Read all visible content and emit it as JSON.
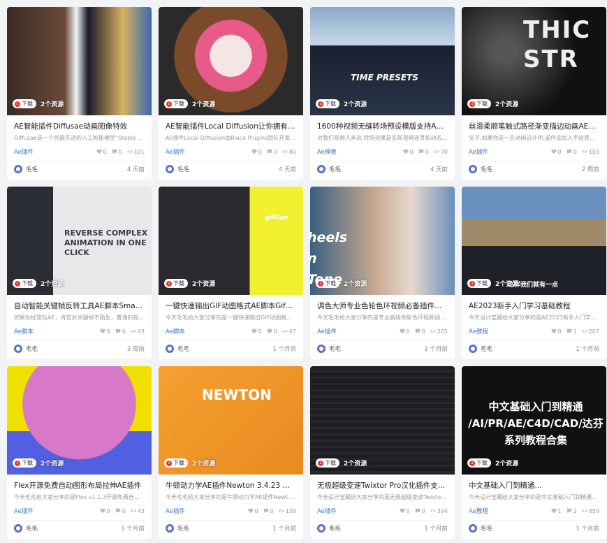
{
  "cards": [
    {
      "title": "AE智能插件Diffusae动画图像特效",
      "desc": "Diffusae是一个将最先进的人工智能模型“Stable D...",
      "tag": "Ae插件",
      "likes": "0",
      "comments": "0",
      "views": "101",
      "author": "毛毛",
      "time": "4 天前",
      "badge": "下载",
      "res": "2个资源",
      "art_text": ""
    },
    {
      "title": "AE智能插件Local Diffusion让你拥有24...",
      "desc": "AE插件Local Diffusion由Blace Plugins团队开发,...",
      "tag": "Ae插件",
      "likes": "0",
      "comments": "0",
      "views": "80",
      "author": "毛毛",
      "time": "4 天前",
      "badge": "下载",
      "res": "2个资源",
      "art_text": ""
    },
    {
      "title": "1600种视频无缝转场预设模版支持AE和...",
      "desc": "对我们视频人来说,转场效果是实现视频连贯和动态...",
      "tag": "Ae模板",
      "likes": "0",
      "comments": "0",
      "views": "70",
      "author": "毛毛",
      "time": "4 天前",
      "badge": "下载",
      "res": "2个资源",
      "art_text": "TIME PRESETS"
    },
    {
      "title": "丝滑柔顺笔触式路径渐变描边动画AE插...",
      "desc": "宝子,如果你是一名动画设计师,或作品加入手绘质...",
      "tag": "Ae插件",
      "likes": "0",
      "comments": "0",
      "views": "103",
      "author": "毛毛",
      "time": "2 周前",
      "badge": "下载",
      "res": "2个资源",
      "art_text": "THIC STR"
    },
    {
      "title": "自动智能关键帧反转工具AE脚本Smart...",
      "desc": "如果你经常玩AE，肯定对关键帧不陌生，普通的视...",
      "tag": "Ae脚本",
      "likes": "0",
      "comments": "0",
      "views": "43",
      "author": "毛毛",
      "time": "3 周前",
      "badge": "下载",
      "res": "2个资源",
      "art_text": "REVERSE COMPLEX ANIMATION IN ONE CLICK"
    },
    {
      "title": "一键快速输出GIF动图格式AE脚本GifGun",
      "desc": "今天毛毛给大家分享的是一键快速输出GIF动图格...",
      "tag": "Ae脚本",
      "likes": "0",
      "comments": "0",
      "views": "67",
      "author": "毛毛",
      "time": "1 个月前",
      "badge": "下载",
      "res": "2个资源",
      "art_text": "gifGun"
    },
    {
      "title": "调色大师专业色轮色环视频必备插件...",
      "desc": "今天毛毛给大家分享的是专业高级色轮色环视频调...",
      "tag": "Ae插件",
      "likes": "0",
      "comments": "0",
      "views": "205",
      "author": "毛毛",
      "time": "1 个月前",
      "badge": "下载",
      "res": "2个资源",
      "art_text": "heels n Tone"
    },
    {
      "title": "AE2023新手入门学习基础教程",
      "desc": "今天设计宝藏给大家分享的是AE2023新手入门学...",
      "tag": "Ae教程",
      "likes": "0",
      "comments": "1",
      "views": "207",
      "author": "毛毛",
      "time": "1 个月前",
      "badge": "下载",
      "res": "2个资源",
      "art_text": "这样我们就有一点"
    },
    {
      "title": "Flex开源免费自动图形布局拉伸AE插件",
      "desc": "今天毛毛给大家分享的是Flex v1.1.3开源免费自动...",
      "tag": "Ae插件",
      "likes": "0",
      "comments": "0",
      "views": "43",
      "author": "毛毛",
      "time": "1 个月前",
      "badge": "下载",
      "res": "2个资源",
      "art_text": ""
    },
    {
      "title": "牛顿动力学AE插件Newton 3.4.23 中文...",
      "desc": "今天毛毛给大家分享的是牛顿动力学AE插件Newto...",
      "tag": "Ae插件",
      "likes": "0",
      "comments": "0",
      "views": "139",
      "author": "毛毛",
      "time": "1 个月前",
      "badge": "下载",
      "res": "2个资源",
      "art_text": "NEWTON"
    },
    {
      "title": "无极超级变速Twixtor Pro汉化插件支持...",
      "desc": "今天设计宝藏给大家分享的是无极超级变速Twixto...",
      "tag": "Ae插件",
      "likes": "0",
      "comments": "0",
      "views": "394",
      "author": "毛毛",
      "time": "1 个月前",
      "badge": "下载",
      "res": "2个资源",
      "art_text": ""
    },
    {
      "title": "中文基础入门到精通...",
      "desc": "今天设计宝藏给大家分享的是中文基础入门到精通...",
      "tag": "Ae教程",
      "likes": "1",
      "comments": "2",
      "views": "859",
      "author": "毛毛",
      "time": "1 个月前",
      "badge": "下载",
      "res": "2个资源",
      "art_text": "中文基础入门到精通 /AI/PR/AE/C4D/CAD/达芬 系列教程合集"
    }
  ]
}
